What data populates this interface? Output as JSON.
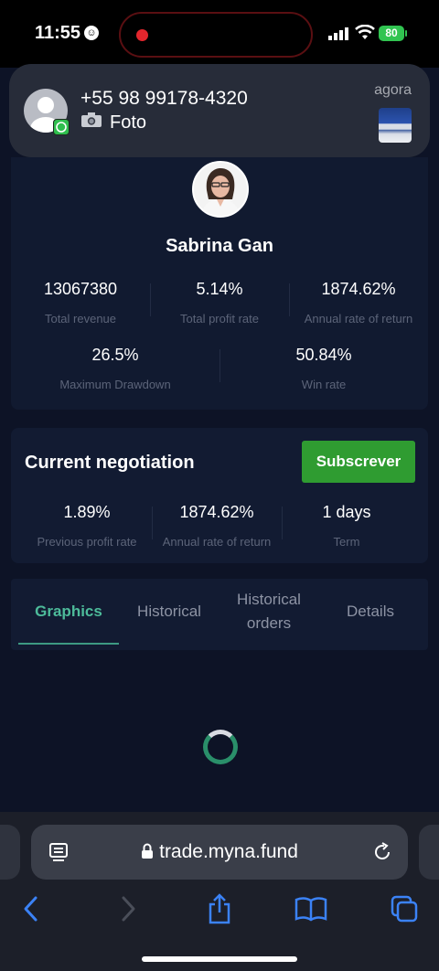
{
  "status_bar": {
    "time": "11:55",
    "battery": "80"
  },
  "notification": {
    "title": "+55 98 99178-4320",
    "subtitle": "Foto",
    "time": "agora"
  },
  "profile": {
    "name": "Sabrina Gan",
    "stats": [
      {
        "value": "13067380",
        "label": "Total revenue"
      },
      {
        "value": "5.14%",
        "label": "Total profit rate"
      },
      {
        "value": "1874.62%",
        "label": "Annual rate of return"
      }
    ],
    "stats2": [
      {
        "value": "26.5%",
        "label": "Maximum Drawdown"
      },
      {
        "value": "50.84%",
        "label": "Win rate"
      }
    ]
  },
  "negotiation": {
    "title": "Current negotiation",
    "subscribe_label": "Subscrever",
    "stats": [
      {
        "value": "1.89%",
        "label": "Previous profit rate"
      },
      {
        "value": "1874.62%",
        "label": "Annual rate of return"
      },
      {
        "value": "1 days",
        "label": "Term"
      }
    ]
  },
  "tabs": [
    {
      "label": "Graphics",
      "active": true
    },
    {
      "label": "Historical",
      "active": false
    },
    {
      "label": "Historical orders",
      "active": false
    },
    {
      "label": "Details",
      "active": false
    }
  ],
  "browser": {
    "url": "trade.myna.fund"
  },
  "colors": {
    "accent_green": "#2f9c31",
    "tab_active": "#4dbb9a",
    "background": "#0d1326"
  }
}
